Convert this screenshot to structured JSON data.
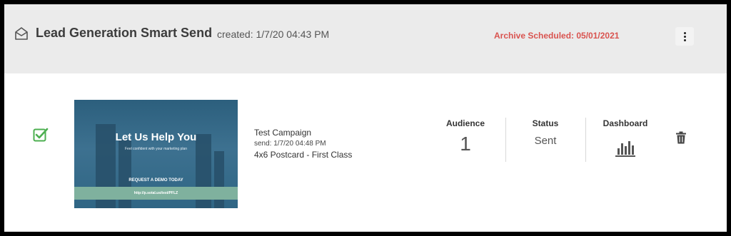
{
  "header": {
    "title": "Lead Generation Smart Send",
    "created": "created: 1/7/20 04:43 PM",
    "archive": "Archive Scheduled: 05/01/2021",
    "envelope_icon": "envelope-open-icon",
    "menu_icon": "kebab-menu-icon"
  },
  "row": {
    "checkbox_icon": "checkbox-checked-icon",
    "checked": true,
    "thumbnail": {
      "headline": "Let Us Help You",
      "subheadline": "Feel confident with your marketing plan",
      "cta": "REQUEST A DEMO TODAY",
      "url": "http://p.sotal.us/test/PFLZ"
    },
    "campaign": {
      "name": "Test Campaign",
      "send": "send: 1/7/20 04:48 PM",
      "type": "4x6 Postcard - First Class"
    },
    "audience": {
      "label": "Audience",
      "value": "1"
    },
    "status": {
      "label": "Status",
      "value": "Sent"
    },
    "dashboard": {
      "label": "Dashboard",
      "icon": "bar-chart-icon"
    },
    "delete_icon": "trash-icon"
  },
  "colors": {
    "header_bg": "#ebebeb",
    "archive_text": "#d9534f",
    "check_green": "#4caf50",
    "icon_gray": "#555555"
  }
}
